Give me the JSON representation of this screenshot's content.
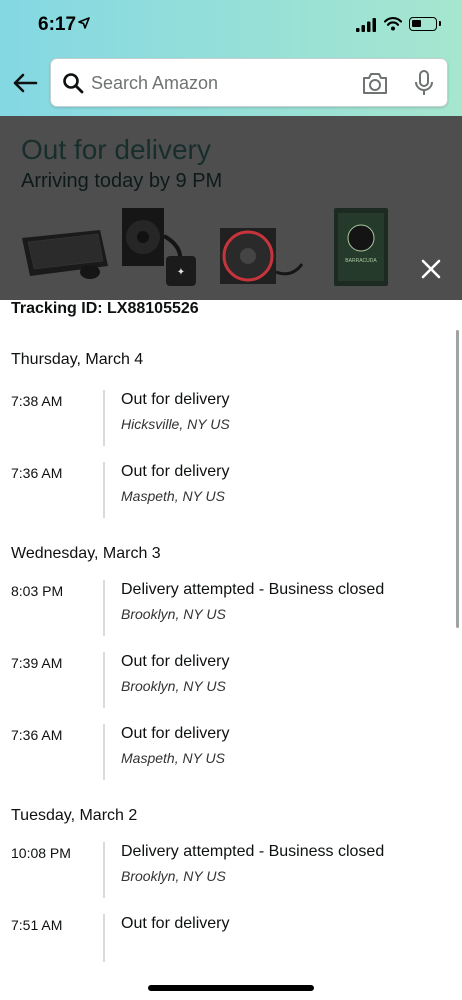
{
  "status_bar": {
    "time": "6:17"
  },
  "search": {
    "placeholder": "Search Amazon",
    "value": ""
  },
  "banner": {
    "title": "Out for delivery",
    "subtitle": "Arriving today by 9 PM",
    "products": [
      "keyboard-mouse-product",
      "cpu-cooler-product",
      "rgb-fan-product",
      "hard-drive-product"
    ]
  },
  "tracking": {
    "label": "Tracking ID: LX88105526"
  },
  "days": [
    {
      "date": "Thursday, March 4",
      "events": [
        {
          "time": "7:38 AM",
          "status": "Out for delivery",
          "location": "Hicksville, NY US"
        },
        {
          "time": "7:36 AM",
          "status": "Out for delivery",
          "location": "Maspeth, NY US"
        }
      ]
    },
    {
      "date": "Wednesday, March 3",
      "events": [
        {
          "time": "8:03 PM",
          "status": "Delivery attempted - Business closed",
          "location": "Brooklyn, NY US"
        },
        {
          "time": "7:39 AM",
          "status": "Out for delivery",
          "location": "Brooklyn, NY US"
        },
        {
          "time": "7:36 AM",
          "status": "Out for delivery",
          "location": "Maspeth, NY US"
        }
      ]
    },
    {
      "date": "Tuesday, March 2",
      "events": [
        {
          "time": "10:08 PM",
          "status": "Delivery attempted - Business closed",
          "location": "Brooklyn, NY US"
        },
        {
          "time": "7:51 AM",
          "status": "Out for delivery",
          "location": ""
        }
      ]
    }
  ],
  "colors": {
    "header_start": "#84d8e3",
    "header_end": "#a6e6ce",
    "banner_overlay": "#4e4e4e",
    "text": "#0f1111"
  }
}
